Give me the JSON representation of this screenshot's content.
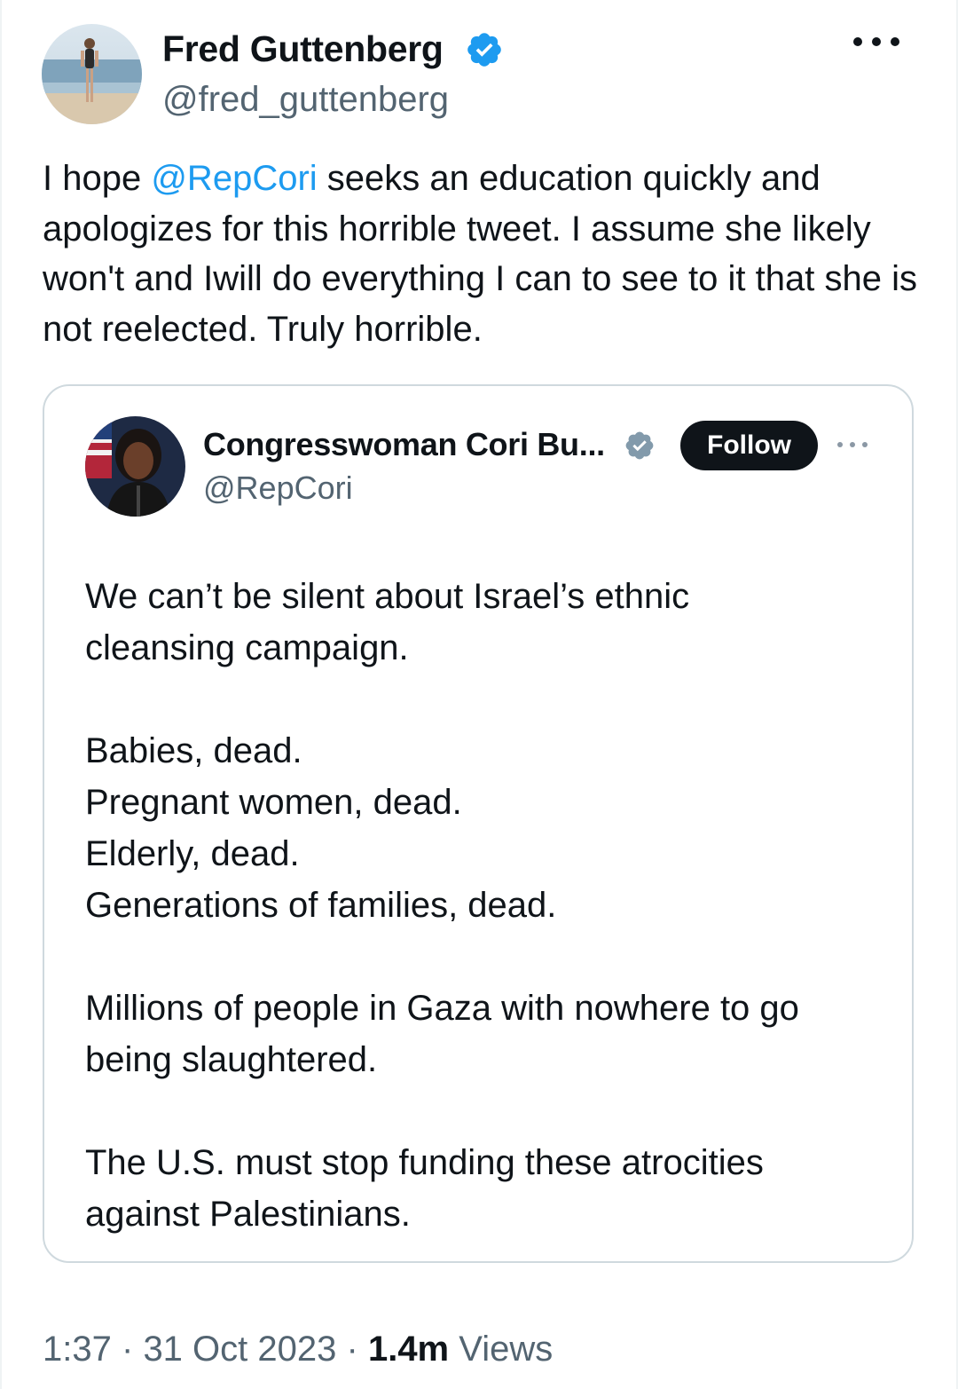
{
  "tweet": {
    "author_name": "Fred Guttenberg",
    "author_handle": "@fred_guttenberg",
    "text_before_mention": "I hope ",
    "mention": "@RepCori",
    "text_after_mention": " seeks an education quickly and apologizes for this horrible tweet.  I assume she likely won't and Iwill do everything I can to see to it that she is not reelected.  Truly horrible.",
    "time": "1:37",
    "date": "31 Oct 2023",
    "views_count": "1.4m",
    "views_label": "Views",
    "separator": "·"
  },
  "quote": {
    "author_name": "Congresswoman Cori Bu...",
    "author_handle": "@RepCori",
    "follow_label": "Follow",
    "paragraphs": [
      [
        "We can’t be silent about Israel’s ethnic",
        "cleansing campaign."
      ],
      [
        "Babies, dead.",
        "Pregnant women, dead.",
        "Elderly, dead.",
        "Generations of families, dead."
      ],
      [
        "Millions of people in Gaza with nowhere to go",
        "being slaughtered."
      ],
      [
        "The U.S. must stop funding these atrocities",
        "against Palestinians."
      ]
    ]
  },
  "colors": {
    "link": "#1d9bf0",
    "verified_blue": "#1d9bf0",
    "verified_gray": "#829aab",
    "secondary_text": "#536471",
    "primary_text": "#0f1419",
    "card_border": "#cfd9de"
  },
  "icons": {
    "verified_badge": "verified-badge-icon",
    "more": "more-icon"
  }
}
